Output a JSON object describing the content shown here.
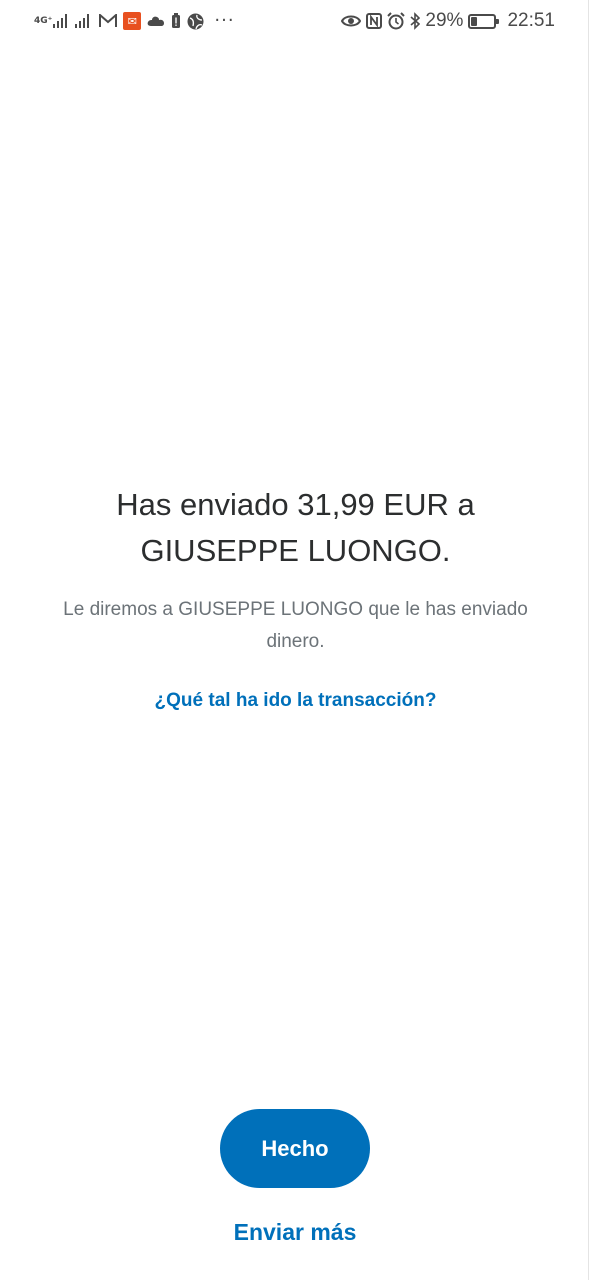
{
  "status_bar": {
    "network_type": "4G⁺",
    "notification_icons": [
      "signal-icon",
      "signal-2-icon",
      "gmail-icon",
      "app-notification-icon",
      "cloud-icon",
      "battery-alert-icon",
      "globe-icon"
    ],
    "more_dots": "···",
    "battery_percent": "29%",
    "battery_level": 0.29,
    "time": "22:51"
  },
  "confirmation": {
    "headline": "Has enviado 31,99 EUR a GIUSEPPE LUONGO.",
    "subtext": "Le diremos a GIUSEPPE LUONGO que le has enviado dinero.",
    "feedback_link": "¿Qué tal ha ido la transacción?"
  },
  "actions": {
    "done_label": "Hecho",
    "send_more_label": "Enviar más"
  },
  "colors": {
    "primary": "#0070ba",
    "text_dark": "#2c2e2f",
    "text_muted": "#6c7378"
  }
}
